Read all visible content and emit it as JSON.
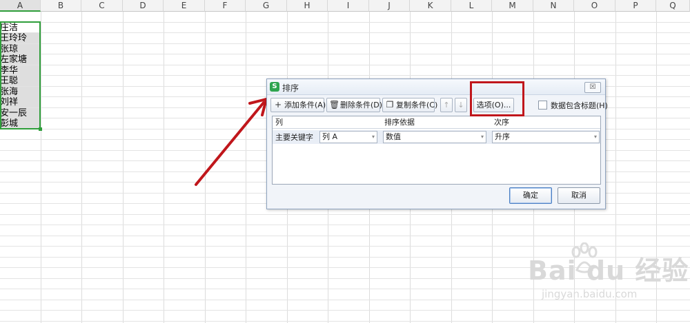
{
  "sheet": {
    "columns": [
      "A",
      "B",
      "C",
      "D",
      "E",
      "F",
      "G",
      "H",
      "I",
      "J",
      "K",
      "L",
      "M",
      "N",
      "O",
      "P",
      "Q"
    ],
    "selected_column": "A",
    "column_a_cells": [
      "庄洁",
      "王玲玲",
      "张琼",
      "左家塘",
      "李华",
      "王聪",
      "张海",
      "刘祥",
      "安一辰",
      "彭城"
    ]
  },
  "dialog": {
    "title": "排序",
    "app_icon": "S",
    "close_label": "☒",
    "toolbar": {
      "add_label": "添加条件(A)",
      "delete_label": "删除条件(D)",
      "copy_label": "复制条件(C)",
      "options_label": "选项(O)...",
      "header_checkbox_label": "数据包含标题(H)"
    },
    "grid": {
      "headers": [
        "列",
        "排序依据",
        "次序"
      ],
      "row": {
        "label": "主要关键字",
        "column_value": "列 A",
        "sort_on_value": "数值",
        "order_value": "升序"
      }
    },
    "ok_label": "确定",
    "cancel_label": "取消"
  },
  "watermark": {
    "brand": "Bai  du 经验",
    "url": "jingyan.baidu.com"
  },
  "colors": {
    "selection_green": "#2e9e3a",
    "annotation_red": "#c0161b"
  }
}
